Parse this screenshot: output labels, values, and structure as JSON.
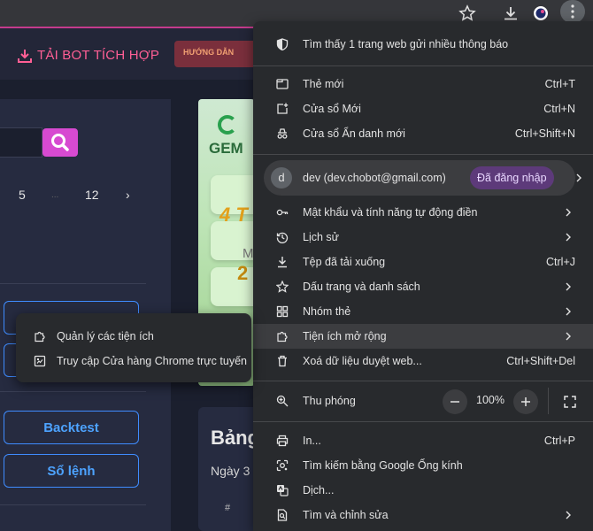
{
  "page": {
    "download_bot": "TẢI BOT TÍCH HỢP",
    "guide_button": "HƯỚNG DẪN",
    "pagination": {
      "page_5": "5",
      "ellipsis": "...",
      "page_12": "12",
      "next": "›"
    },
    "side_buttons": {
      "backtest": "Backtest",
      "orders": "Sổ lệnh"
    },
    "banner": {
      "brand": "GEM",
      "big_text": "4 T",
      "m_text": "M",
      "num_text": "2"
    },
    "card": {
      "title": "Bảng",
      "date": "Ngày 3",
      "col_hash": "#"
    }
  },
  "menu": {
    "notification": "Tìm thấy 1 trang web gửi nhiều thông báo",
    "new_tab": {
      "label": "Thẻ mới",
      "shortcut": "Ctrl+T"
    },
    "new_window": {
      "label": "Cửa sổ Mới",
      "shortcut": "Ctrl+N"
    },
    "incognito": {
      "label": "Cửa sổ Ẩn danh mới",
      "shortcut": "Ctrl+Shift+N"
    },
    "profile": {
      "avatar_letter": "d",
      "email": "dev (dev.chobot@gmail.com)",
      "status": "Đã đăng nhập"
    },
    "passwords": {
      "label": "Mật khẩu và tính năng tự động điền"
    },
    "history": {
      "label": "Lịch sử"
    },
    "downloads": {
      "label": "Tệp đã tải xuống",
      "shortcut": "Ctrl+J"
    },
    "bookmarks": {
      "label": "Dấu trang và danh sách"
    },
    "tab_groups": {
      "label": "Nhóm thẻ"
    },
    "extensions": {
      "label": "Tiện ích mở rộng"
    },
    "clear_data": {
      "label": "Xoá dữ liệu duyệt web...",
      "shortcut": "Ctrl+Shift+Del"
    },
    "zoom": {
      "label": "Thu phóng",
      "value": "100%",
      "minus": "−",
      "plus": "+"
    },
    "print": {
      "label": "In...",
      "shortcut": "Ctrl+P"
    },
    "google_lens": {
      "label": "Tìm kiếm bằng Google Ống kính"
    },
    "translate": {
      "label": "Dịch..."
    },
    "find_edit": {
      "label": "Tìm và chỉnh sửa"
    }
  },
  "submenu": {
    "manage_extensions": "Quản lý các tiện ích",
    "chrome_web_store": "Truy cập Cửa hàng Chrome trực tuyến"
  },
  "colors": {
    "menu_bg": "#282a2d",
    "highlight": "#3c3d40",
    "badge_bg": "#5d3a7a",
    "accent_pink": "#ff5f95",
    "accent_blue": "#4da3ff"
  }
}
